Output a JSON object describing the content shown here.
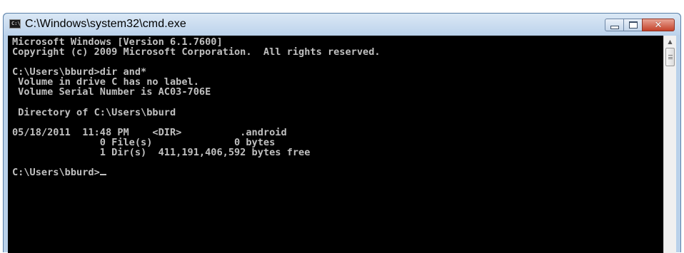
{
  "window": {
    "title": "C:\\Windows\\system32\\cmd.exe",
    "icon_label": "C:\\"
  },
  "controls": {
    "minimize": "minimize-icon",
    "maximize": "maximize-icon",
    "close": "close-icon",
    "close_glyph": "✕"
  },
  "console": {
    "lines": [
      "Microsoft Windows [Version 6.1.7600]",
      "Copyright (c) 2009 Microsoft Corporation.  All rights reserved.",
      "",
      "C:\\Users\\bburd>dir and*",
      " Volume in drive C has no label.",
      " Volume Serial Number is AC03-706E",
      "",
      " Directory of C:\\Users\\bburd",
      "",
      "05/18/2011  11:48 PM    <DIR>          .android",
      "               0 File(s)              0 bytes",
      "               1 Dir(s)  411,191,406,592 bytes free",
      ""
    ],
    "prompt": "C:\\Users\\bburd>"
  },
  "scrollbar": {
    "up_arrow": "▲"
  },
  "colors": {
    "console_background": "#000000",
    "console_text": "#c0c0c0",
    "titlebar": "#bcd3ec",
    "close_button": "#c4422a"
  }
}
